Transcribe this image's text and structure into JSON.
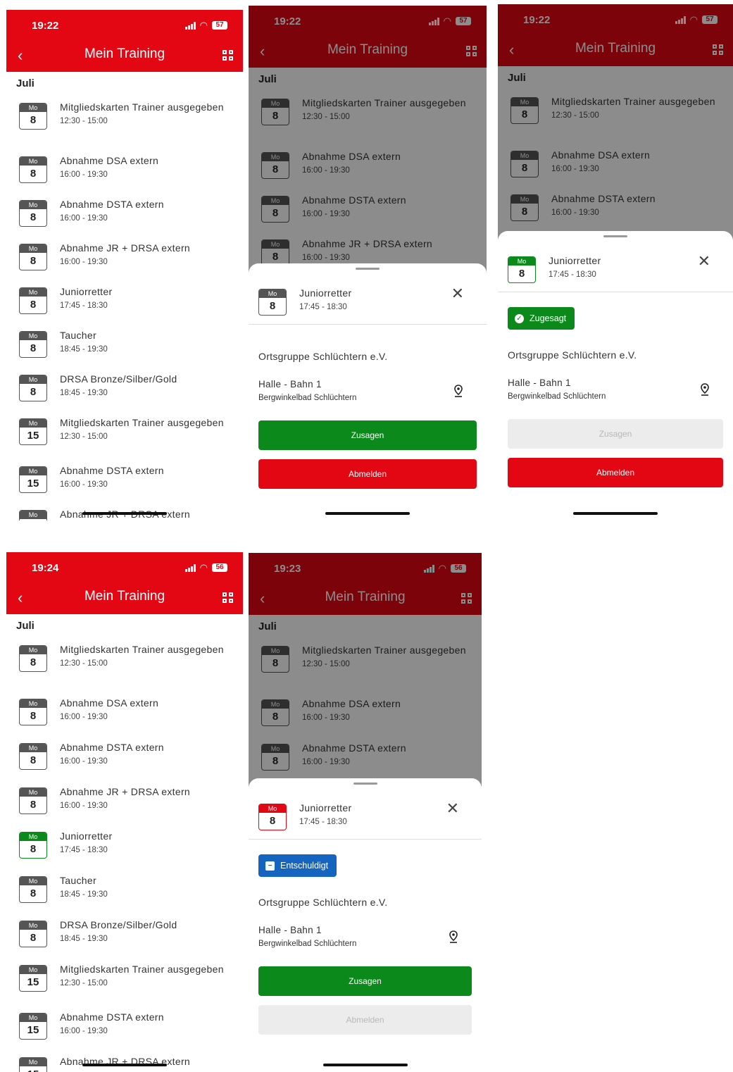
{
  "colors": {
    "brand": "#e30613",
    "green": "#0b8a1b",
    "blue": "#1565c0",
    "disabled": "#ececec"
  },
  "common": {
    "title": "Mein Training",
    "month": "Juli",
    "org": "Ortsgruppe Schlüchtern e.V.",
    "venue_line1": "Halle - Bahn 1",
    "venue_line2": "Bergwinkelbad Schlüchtern",
    "zusagen": "Zusagen",
    "abmelden": "Abmelden",
    "sheet_event": {
      "day": "Mo",
      "num": "8",
      "title": "Juniorretter",
      "time": "17:45 - 18:30"
    }
  },
  "events": [
    {
      "day": "Mo",
      "num": "8",
      "title": "Mitgliedskarten Trainer ausgegeben",
      "time": "12:30 - 15:00"
    },
    {
      "day": "Mo",
      "num": "8",
      "title": "Abnahme DSA extern",
      "time": "16:00 - 19:30"
    },
    {
      "day": "Mo",
      "num": "8",
      "title": "Abnahme DSTA extern",
      "time": "16:00 - 19:30"
    },
    {
      "day": "Mo",
      "num": "8",
      "title": "Abnahme JR + DRSA extern",
      "time": "16:00 - 19:30"
    },
    {
      "day": "Mo",
      "num": "8",
      "title": "Juniorretter",
      "time": "17:45 - 18:30"
    },
    {
      "day": "Mo",
      "num": "8",
      "title": "Taucher",
      "time": "18:45 - 19:30"
    },
    {
      "day": "Mo",
      "num": "8",
      "title": "DRSA Bronze/Silber/Gold",
      "time": "18:45 - 19:30"
    },
    {
      "day": "Mo",
      "num": "15",
      "title": "Mitgliedskarten Trainer ausgegeben",
      "time": "12:30 - 15:00"
    },
    {
      "day": "Mo",
      "num": "15",
      "title": "Abnahme DSTA extern",
      "time": "16:00 - 19:30"
    },
    {
      "day": "Mo",
      "num": "15",
      "title": "Abnahme JR + DRSA extern",
      "time": ""
    }
  ],
  "screens": [
    {
      "time": "19:22",
      "battery": "57",
      "highlight_index": -1,
      "sheet": null
    },
    {
      "time": "19:22",
      "battery": "57",
      "highlight_index": -1,
      "sheet": {
        "badge": null,
        "cal_color": "gray",
        "zusagen_enabled": true,
        "abmelden_enabled": true
      }
    },
    {
      "time": "19:22",
      "battery": "57",
      "highlight_index": -1,
      "sheet": {
        "badge": {
          "label": "Zugesagt",
          "color": "green",
          "icon": "check-circle-icon"
        },
        "cal_color": "green",
        "zusagen_enabled": false,
        "abmelden_enabled": true
      }
    },
    {
      "time": "19:24",
      "battery": "56",
      "highlight_index": 4,
      "sheet": null
    },
    {
      "time": "19:23",
      "battery": "56",
      "highlight_index": -1,
      "sheet": {
        "badge": {
          "label": "Entschuldigt",
          "color": "blue",
          "icon": "minus-square-icon"
        },
        "cal_color": "red",
        "zusagen_enabled": true,
        "abmelden_enabled": false
      }
    }
  ]
}
